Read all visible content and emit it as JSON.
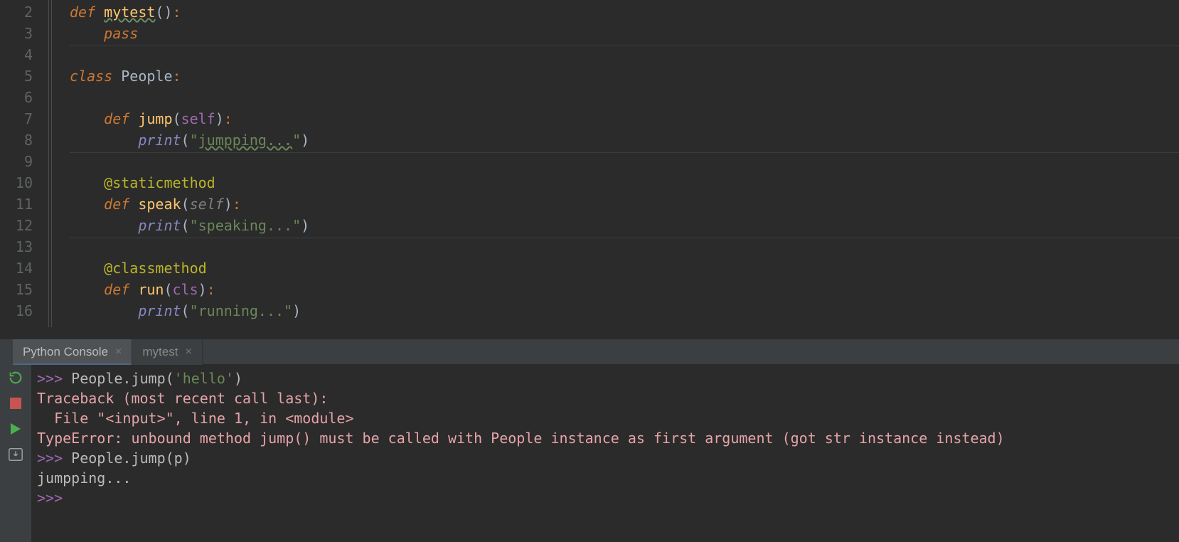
{
  "editor": {
    "line_numbers": [
      "2",
      "3",
      "4",
      "5",
      "6",
      "7",
      "8",
      "9",
      "10",
      "11",
      "12",
      "13",
      "14",
      "15",
      "16"
    ],
    "code": {
      "l2": {
        "def": "def",
        "name": "mytest",
        "p1": "(",
        "p2": ")",
        "colon": ":"
      },
      "l3": {
        "pass": "pass"
      },
      "l5": {
        "class": "class",
        "name": "People",
        "colon": ":"
      },
      "l7": {
        "def": "def",
        "name": "jump",
        "p1": "(",
        "self": "self",
        "p2": ")",
        "colon": ":"
      },
      "l8": {
        "print": "print",
        "p1": "(",
        "q1": "\"",
        "str": "jumpping...",
        "q2": "\"",
        "p2": ")"
      },
      "l10": {
        "decor": "@staticmethod"
      },
      "l11": {
        "def": "def",
        "name": "speak",
        "p1": "(",
        "self": "self",
        "p2": ")",
        "colon": ":"
      },
      "l12": {
        "print": "print",
        "p1": "(",
        "str": "\"speaking...\"",
        "p2": ")"
      },
      "l14": {
        "decor": "@classmethod"
      },
      "l15": {
        "def": "def",
        "name": "run",
        "p1": "(",
        "cls": "cls",
        "p2": ")",
        "colon": ":"
      },
      "l16": {
        "print": "print",
        "p1": "(",
        "str": "\"running...\"",
        "p2": ")"
      }
    }
  },
  "tabs": {
    "t1": "Python Console",
    "t2": "mytest"
  },
  "console": {
    "prompt": ">>>",
    "l1_a": " People.jump(",
    "l1_str": "'hello'",
    "l1_b": ")",
    "l2": "Traceback (most recent call last):",
    "l3": "  File \"<input>\", line 1, in <module>",
    "l4": "TypeError: unbound method jump() must be called with People instance as first argument (got str instance instead)",
    "l5_a": " People.jump(p)",
    "l6": "jumpping...",
    "l7_prompt": ">>>"
  }
}
